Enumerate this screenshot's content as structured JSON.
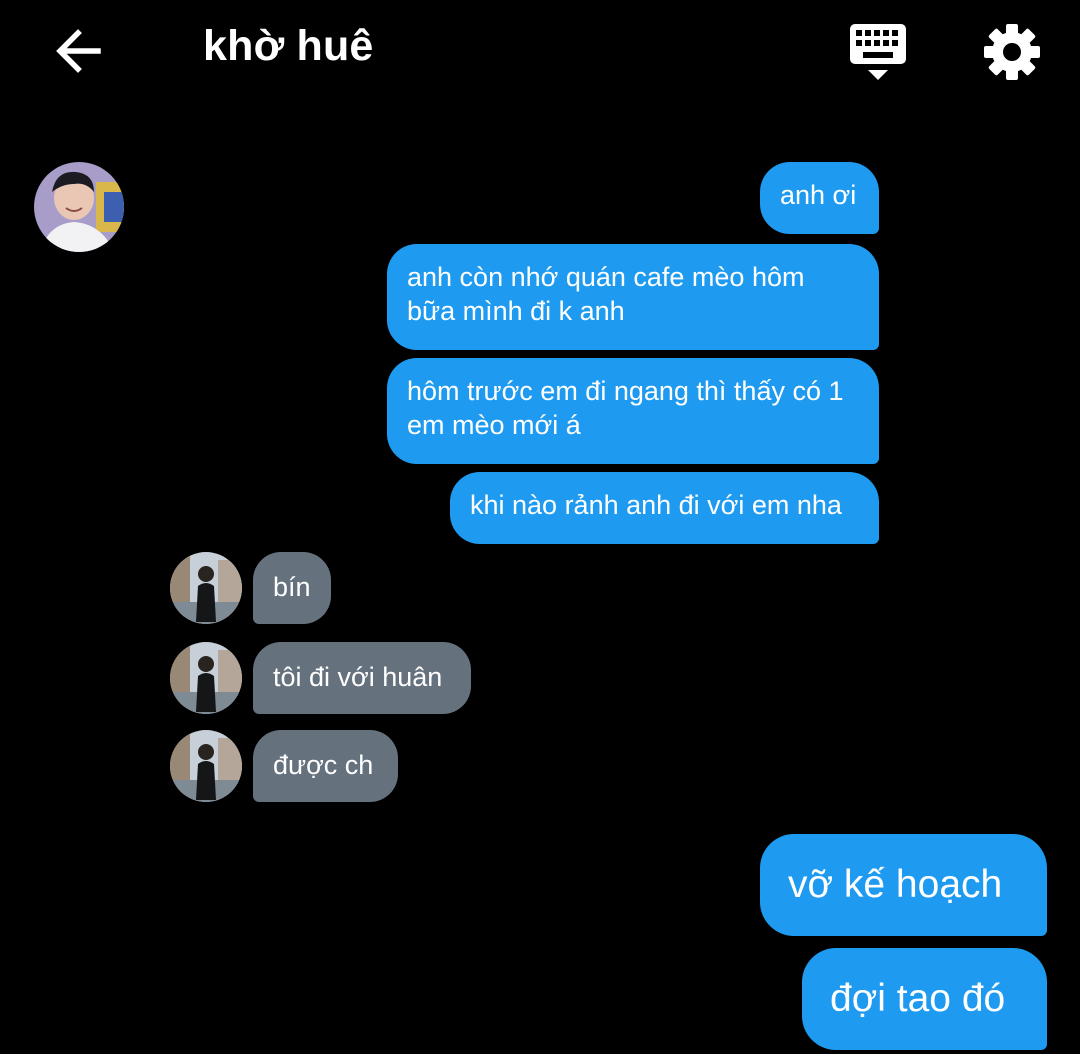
{
  "header": {
    "title": "khờ huê",
    "back_icon": "arrow-left-icon",
    "keyboard_icon": "keyboard-icon",
    "settings_icon": "gear-icon"
  },
  "messages": [
    {
      "direction": "out",
      "text": "anh ơi"
    },
    {
      "direction": "out",
      "text": "anh còn nhớ quán cafe mèo hôm bữa mình đi k anh"
    },
    {
      "direction": "out",
      "text": "hôm trước em đi ngang thì thấy có 1 em mèo mới á"
    },
    {
      "direction": "out",
      "text": "khi nào rảnh anh đi với em nha"
    },
    {
      "direction": "in",
      "text": "bín"
    },
    {
      "direction": "in",
      "text": "tôi đi với huân"
    },
    {
      "direction": "in",
      "text": "được ch"
    },
    {
      "direction": "out",
      "text": "vỡ kế hoạch"
    },
    {
      "direction": "out",
      "text": "đợi tao đó"
    }
  ],
  "colors": {
    "background": "#000000",
    "outgoing_bubble": "#1e9bf0",
    "incoming_bubble": "#66717e",
    "text": "#ffffff"
  }
}
